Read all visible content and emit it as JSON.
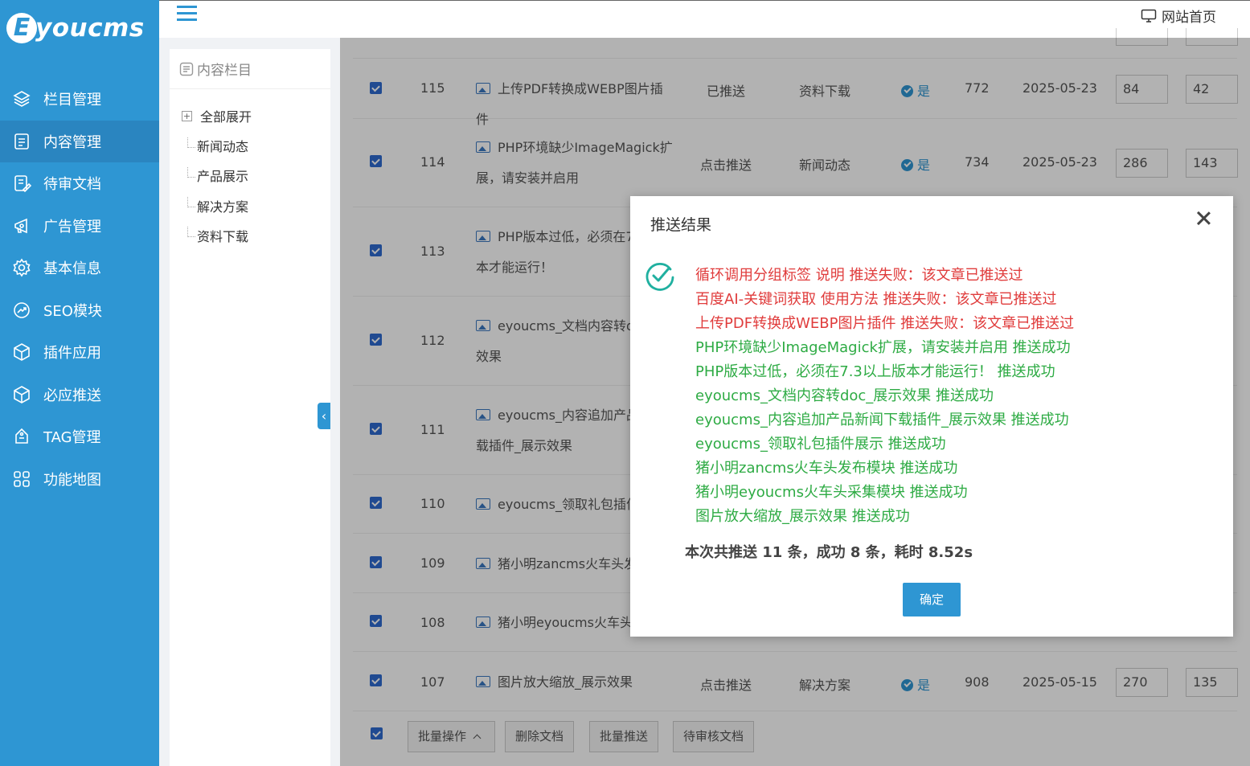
{
  "sidebar": {
    "logo_letter": "E",
    "logo_text": "youcms",
    "items": [
      {
        "label": "栏目管理",
        "icon": "layers-icon"
      },
      {
        "label": "内容管理",
        "icon": "document-icon"
      },
      {
        "label": "待审文档",
        "icon": "review-icon"
      },
      {
        "label": "广告管理",
        "icon": "ad-icon"
      },
      {
        "label": "基本信息",
        "icon": "gear-icon"
      },
      {
        "label": "SEO模块",
        "icon": "seo-icon"
      },
      {
        "label": "插件应用",
        "icon": "plugin-icon"
      },
      {
        "label": "必应推送",
        "icon": "cube-icon"
      },
      {
        "label": "TAG管理",
        "icon": "tag-icon"
      },
      {
        "label": "功能地图",
        "icon": "grid-icon"
      }
    ],
    "active_index": 1
  },
  "header": {
    "site_home": "网站首页"
  },
  "column_panel": {
    "title": "内容栏目",
    "expand_all": "全部展开",
    "nodes": [
      "新闻动态",
      "产品展示",
      "解决方案",
      "资料下载"
    ]
  },
  "table": {
    "rows": [
      {
        "id": "115",
        "title_l1": "上传PDF转换成WEBP图片插件",
        "title_l2": "",
        "push": "已推送",
        "category": "资料下载",
        "flag": "是",
        "views": "772",
        "date": "2025-05-23",
        "sort1": "84",
        "sort2": "42"
      },
      {
        "id": "114",
        "title_l1": "PHP环境缺少ImageMagick扩",
        "title_l2": "展，请安装并启用",
        "push": "点击推送",
        "category": "新闻动态",
        "flag": "是",
        "views": "734",
        "date": "2025-05-23",
        "sort1": "286",
        "sort2": "143"
      },
      {
        "id": "113",
        "title_l1": "PHP版本过低，必须在7",
        "title_l2": "本才能运行！"
      },
      {
        "id": "112",
        "title_l1": "eyoucms_文档内容转do",
        "title_l2": "效果"
      },
      {
        "id": "111",
        "title_l1": "eyoucms_内容追加产品",
        "title_l2": "载插件_展示效果"
      },
      {
        "id": "110",
        "title_l1": "eyoucms_领取礼包插件"
      },
      {
        "id": "109",
        "title_l1": "猪小明zancms火车头发"
      },
      {
        "id": "108",
        "title_l1": "猪小明eyoucms火车头"
      },
      {
        "id": "107",
        "title_l1": "图片放大缩放_展示效果",
        "title_l2": "",
        "push": "点击推送",
        "category": "解决方案",
        "flag": "是",
        "views": "908",
        "date": "2025-05-15",
        "sort1": "270",
        "sort2": "135"
      }
    ]
  },
  "bottom_actions": {
    "batch_ops": "批量操作",
    "delete_docs": "删除文档",
    "batch_push": "批量推送",
    "pending_docs": "待审核文档"
  },
  "modal": {
    "title": "推送结果",
    "results": [
      {
        "text": "循环调用分组标签 说明 推送失败：该文章已推送过",
        "status": "fail"
      },
      {
        "text": "百度AI-关键词获取 使用方法 推送失败：该文章已推送过",
        "status": "fail"
      },
      {
        "text": "上传PDF转换成WEBP图片插件 推送失败：该文章已推送过",
        "status": "fail"
      },
      {
        "text": "PHP环境缺少ImageMagick扩展，请安装并启用 推送成功",
        "status": "ok"
      },
      {
        "text": "PHP版本过低，必须在7.3以上版本才能运行！ 推送成功",
        "status": "ok"
      },
      {
        "text": "eyoucms_文档内容转doc_展示效果 推送成功",
        "status": "ok"
      },
      {
        "text": "eyoucms_内容追加产品新闻下载插件_展示效果 推送成功",
        "status": "ok"
      },
      {
        "text": "eyoucms_领取礼包插件展示 推送成功",
        "status": "ok"
      },
      {
        "text": "猪小明zancms火车头发布模块 推送成功",
        "status": "ok"
      },
      {
        "text": "猪小明eyoucms火车头采集模块 推送成功",
        "status": "ok"
      },
      {
        "text": "图片放大缩放_展示效果 推送成功",
        "status": "ok"
      }
    ],
    "summary": "本次共推送 11 条，成功 8 条，耗时 8.52s",
    "confirm": "确定"
  },
  "colors": {
    "sidebar_bg": "#2e96d3",
    "fail": "#e03c3c",
    "success": "#2eab44"
  }
}
